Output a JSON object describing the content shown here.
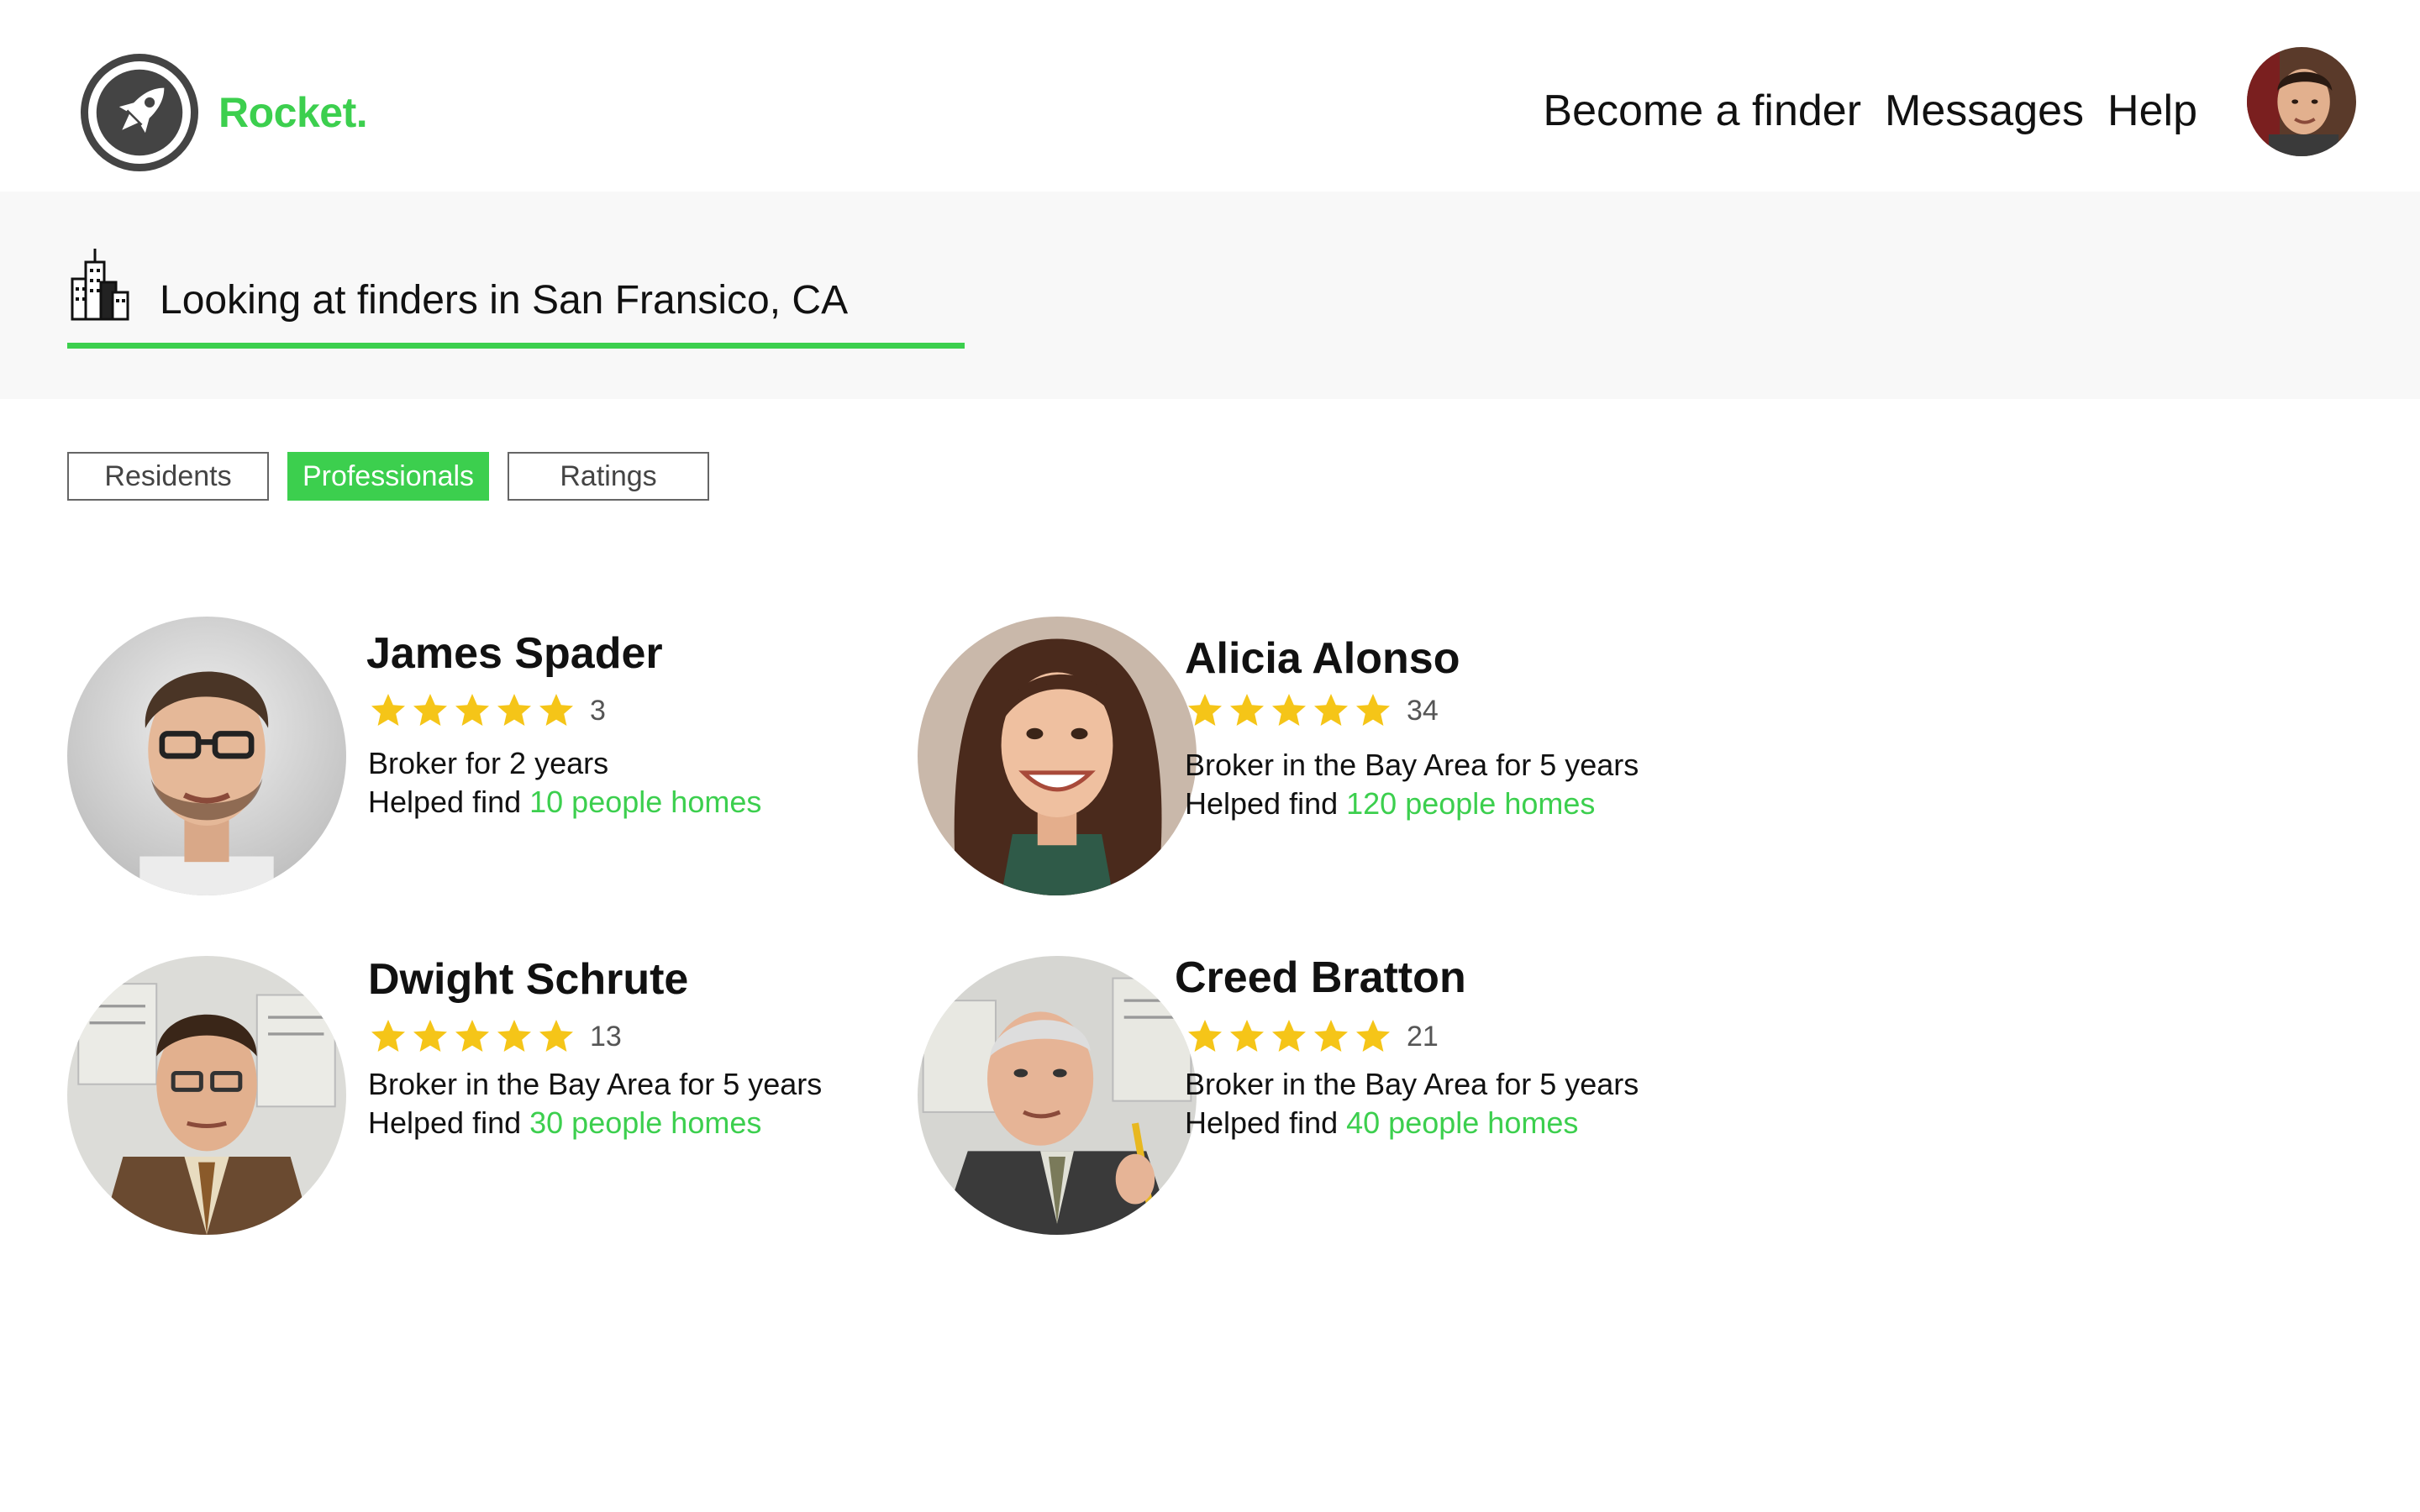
{
  "header": {
    "brand": "Rocket.",
    "logo_icon": "rocket-icon",
    "nav": [
      {
        "label": "Become a finder"
      },
      {
        "label": "Messages"
      },
      {
        "label": "Help"
      }
    ],
    "avatar_icon": "user-avatar"
  },
  "location": {
    "icon": "city-buildings-icon",
    "text": "Looking at finders in San Fransico, CA"
  },
  "tabs": [
    {
      "label": "Residents",
      "active": false
    },
    {
      "label": "Professionals",
      "active": true
    },
    {
      "label": "Ratings",
      "active": false
    }
  ],
  "finders": [
    {
      "name": "James Spader",
      "stars": 5,
      "rating_count": "3",
      "description": "Broker for 2 years",
      "helped_prefix": "Helped find ",
      "helped_link": "10 people homes"
    },
    {
      "name": "Alicia Alonso",
      "stars": 5,
      "rating_count": "34",
      "description": "Broker in the Bay Area for 5 years",
      "helped_prefix": "Helped find ",
      "helped_link": "120 people homes"
    },
    {
      "name": "Dwight Schrute",
      "stars": 5,
      "rating_count": "13",
      "description": "Broker in the Bay Area for 5 years",
      "helped_prefix": "Helped find ",
      "helped_link": "30 people homes"
    },
    {
      "name": "Creed Bratton",
      "stars": 5,
      "rating_count": "21",
      "description": "Broker in the Bay Area for 5 years",
      "helped_prefix": "Helped find ",
      "helped_link": "40 people homes"
    }
  ],
  "colors": {
    "accent": "#3ccf4e",
    "star": "#f5c518",
    "location_bg": "#f8f8f8"
  }
}
